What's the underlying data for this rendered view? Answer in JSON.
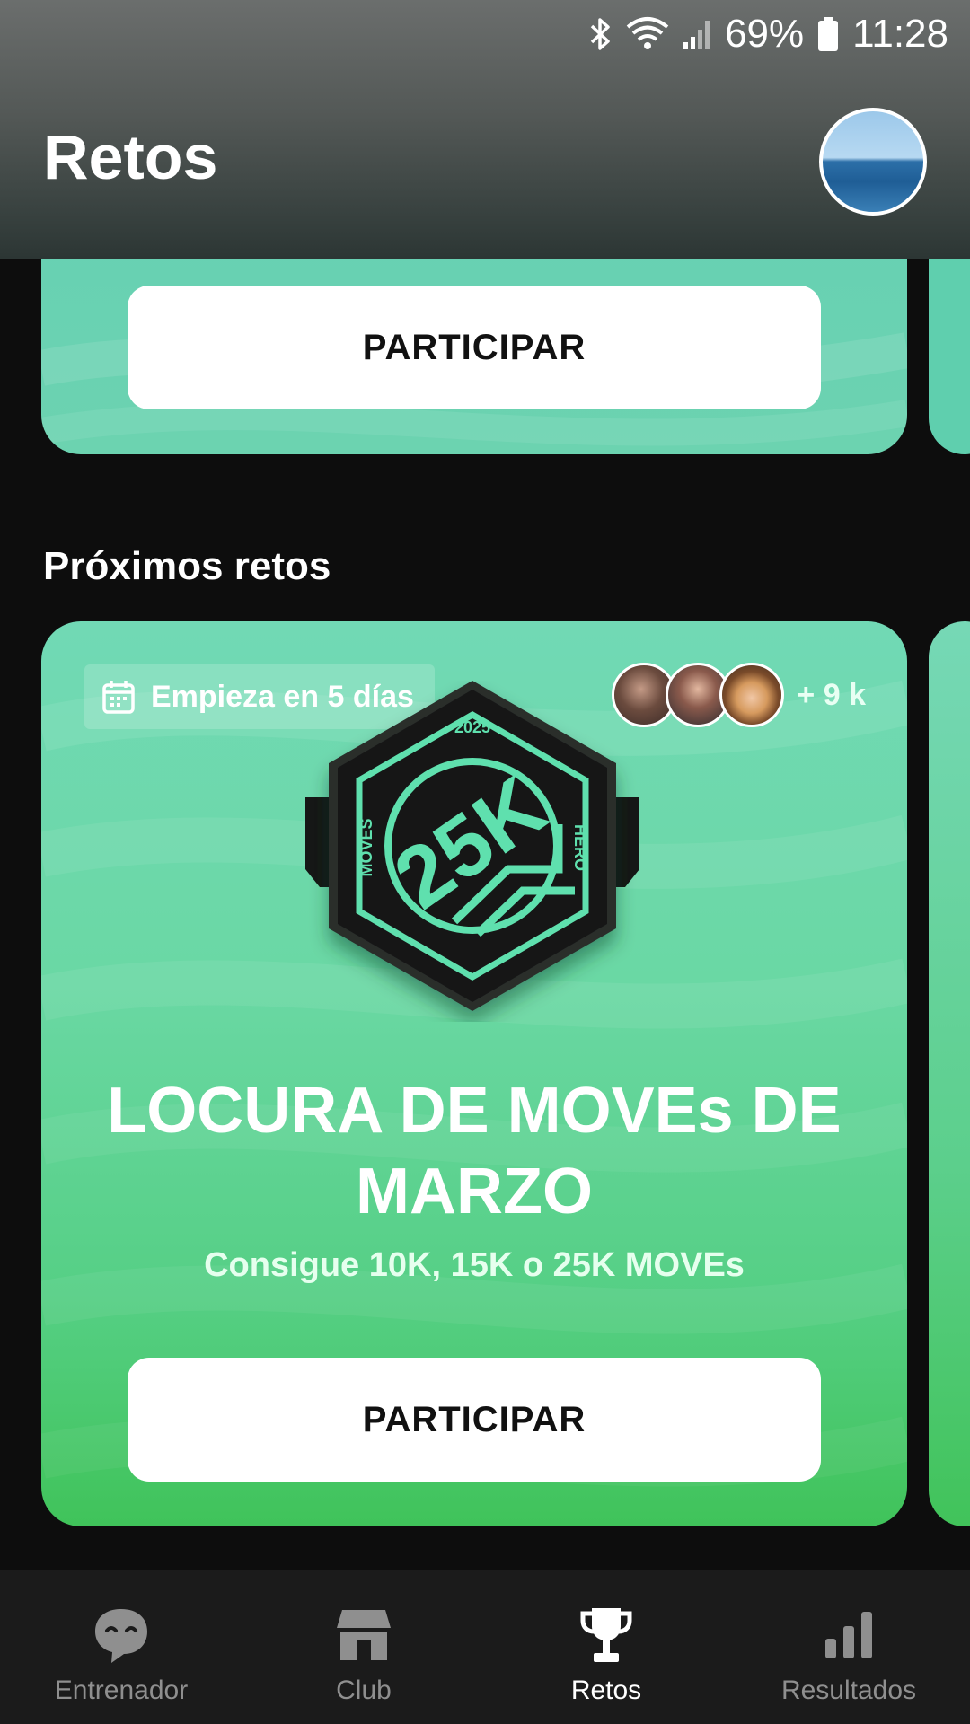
{
  "status_bar": {
    "battery": "69%",
    "time": "11:28"
  },
  "header": {
    "title": "Retos"
  },
  "card_top": {
    "button_label": "PARTICIPAR"
  },
  "section": {
    "title": "Próximos retos"
  },
  "card_main": {
    "start_label": "Empieza en 5 días",
    "participants_count": "+ 9 k",
    "badge_year": "2025",
    "badge_center": "25K",
    "badge_left": "MOVES",
    "badge_right": "HERO",
    "title": "LOCURA DE MOVEs DE MARZO",
    "subtitle": "Consigue 10K, 15K o 25K MOVEs",
    "button_label": "PARTICIPAR"
  },
  "nav": {
    "items": [
      {
        "label": "Entrenador",
        "icon": "chat-face-icon",
        "active": false
      },
      {
        "label": "Club",
        "icon": "store-icon",
        "active": false
      },
      {
        "label": "Retos",
        "icon": "trophy-icon",
        "active": true
      },
      {
        "label": "Resultados",
        "icon": "bar-chart-icon",
        "active": false
      }
    ]
  },
  "colors": {
    "accent_green": "#5fd9a6",
    "badge_dark": "#1c1f1e",
    "nav_bg": "#1b1b1b"
  }
}
